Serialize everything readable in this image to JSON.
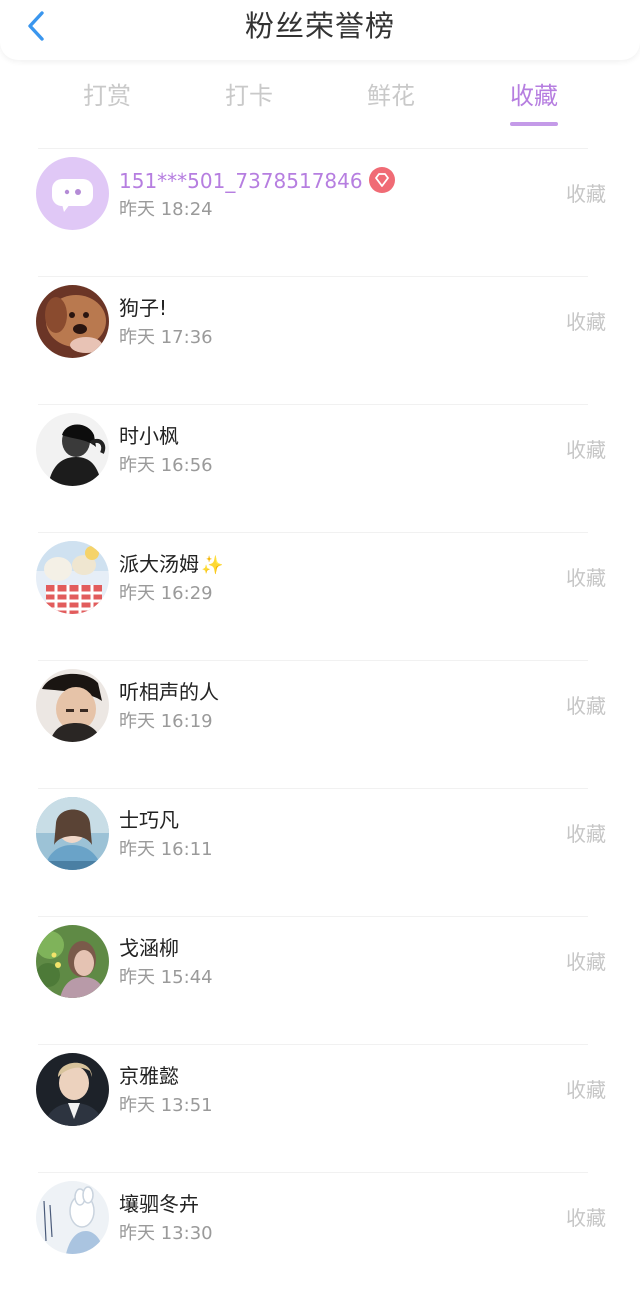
{
  "header": {
    "title": "粉丝荣誉榜",
    "back_icon": "chevron-left-icon"
  },
  "colors": {
    "accent": "#b67ee0",
    "back": "#3a96ee",
    "inactive": "#c9c9c9",
    "action": "#c6c6c6",
    "time": "#9a9a9a",
    "badge": "#f06b75"
  },
  "tabs": [
    {
      "label": "打赏",
      "active": false
    },
    {
      "label": "打卡",
      "active": false
    },
    {
      "label": "鲜花",
      "active": false
    },
    {
      "label": "收藏",
      "active": true
    }
  ],
  "fans": [
    {
      "name": "151***501_7378517846",
      "time": "昨天 18:24",
      "action": "收藏"
    },
    {
      "name": "狗子!",
      "time": "昨天 17:36",
      "action": "收藏"
    },
    {
      "name": "时小枫",
      "time": "昨天 16:56",
      "action": "收藏"
    },
    {
      "name": "派大汤姆",
      "time": "昨天 16:29",
      "action": "收藏"
    },
    {
      "name": "听相声的人",
      "time": "昨天 16:19",
      "action": "收藏"
    },
    {
      "name": "士巧凡",
      "time": "昨天 16:11",
      "action": "收藏"
    },
    {
      "name": "戈涵柳",
      "time": "昨天 15:44",
      "action": "收藏"
    },
    {
      "name": "京雅懿",
      "time": "昨天 13:51",
      "action": "收藏"
    },
    {
      "name": "壤驷冬卉",
      "time": "昨天 13:30",
      "action": "收藏"
    }
  ]
}
